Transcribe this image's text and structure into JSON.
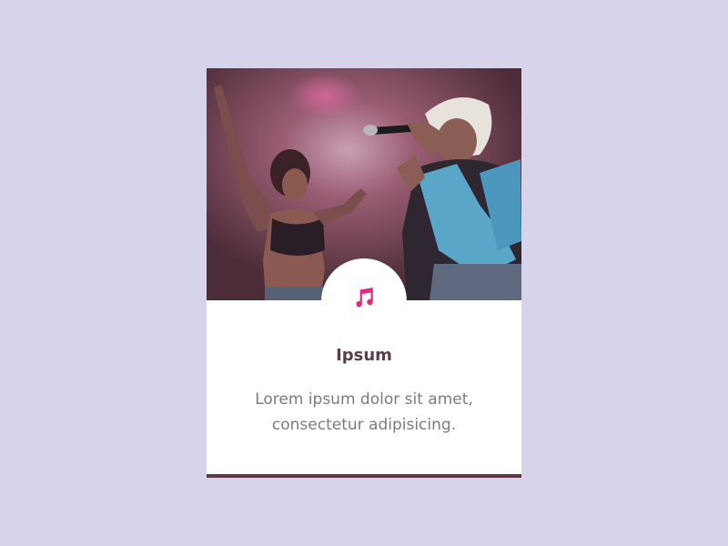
{
  "card": {
    "image_alt": "",
    "icon": "music-note-icon",
    "title": "Ipsum",
    "description": "Lorem ipsum dolor sit amet, consectetur adipisicing."
  },
  "colors": {
    "background": "#d7d3ea",
    "accent": "#e2297f",
    "bottom_border": "#5e3a48",
    "title_text": "#5a3e4b",
    "body_text": "#7a7a86"
  }
}
